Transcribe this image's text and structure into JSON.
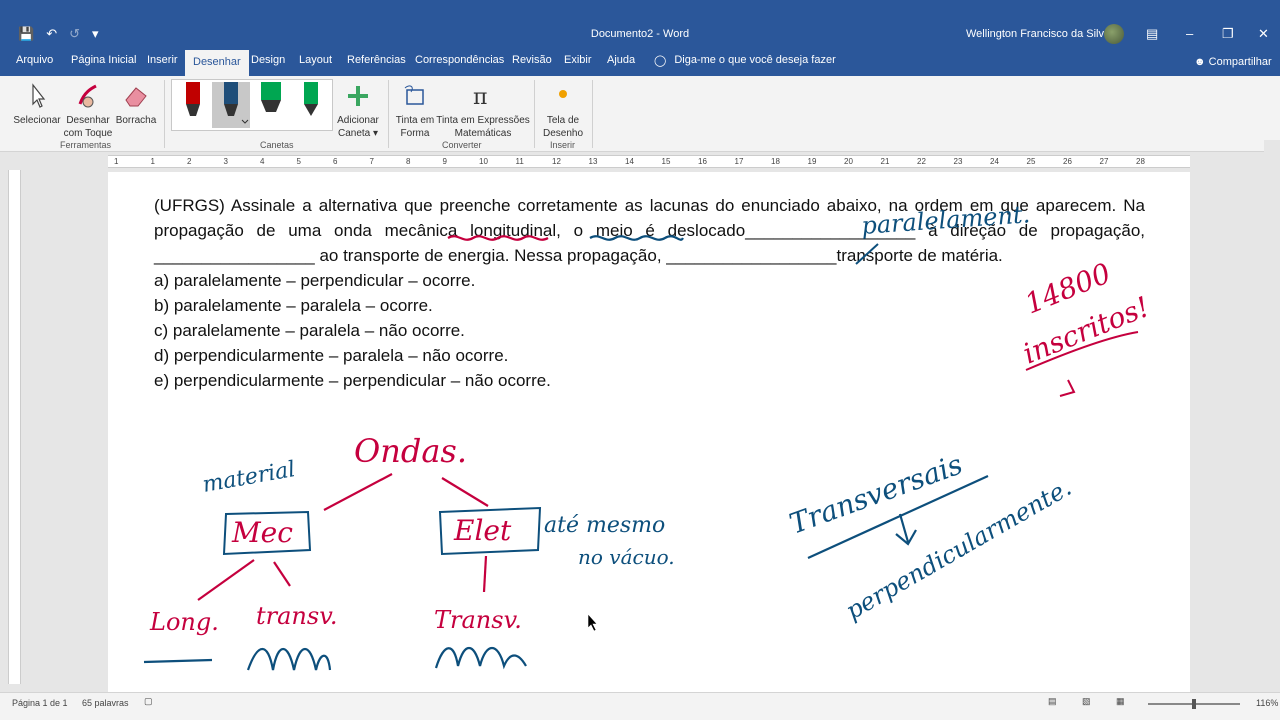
{
  "window": {
    "title": "Documento2  -  Word",
    "user": "Wellington Francisco da Silva"
  },
  "tabs": [
    "Arquivo",
    "Página Inicial",
    "Inserir",
    "Desenhar",
    "Design",
    "Layout",
    "Referências",
    "Correspondências",
    "Revisão",
    "Exibir",
    "Ajuda"
  ],
  "active_tab": "Desenhar",
  "tell_me": "Diga-me o que você deseja fazer",
  "share": "Compartilhar",
  "ribbon": {
    "select": "Selecionar",
    "draw_touch_1": "Desenhar",
    "draw_touch_2": "com Toque",
    "eraser": "Borracha",
    "group_tools": "Ferramentas",
    "group_pens": "Canetas",
    "add_pen_1": "Adicionar",
    "add_pen_2": "Caneta",
    "ink_shape_1": "Tinta em",
    "ink_shape_2": "Forma",
    "ink_math_1": "Tinta em Expressões",
    "ink_math_2": "Matemáticas",
    "group_convert": "Converter",
    "canvas_1": "Tela de",
    "canvas_2": "Desenho",
    "group_insert": "Inserir",
    "pen_colors": [
      "#c00000",
      "#1f4e79",
      "#00a651",
      "#00a651"
    ]
  },
  "ruler_numbers": [
    "1",
    "1",
    "2",
    "3",
    "4",
    "5",
    "6",
    "7",
    "8",
    "9",
    "10",
    "11",
    "12",
    "13",
    "14",
    "15",
    "16",
    "17",
    "18",
    "19",
    "20",
    "21",
    "22",
    "23",
    "24",
    "25",
    "26",
    "27",
    "28"
  ],
  "document": {
    "paragraph": "(UFRGS) Assinale a alternativa que preenche corretamente as lacunas do enunciado abaixo, na ordem em que aparecem. Na propagação de uma onda mecânica longitudinal, o meio é deslocado__________________ à direção de propagação, _________________ ao transporte de energia.  Nessa propagação, __________________transporte de matéria.",
    "options": [
      "a) paralelamente – perpendicular – ocorre.",
      "b) paralelamente – paralela – ocorre.",
      "c) paralelamente – paralela – não ocorre.",
      "d) perpendicularmente – paralela – não ocorre.",
      "e) perpendicularmente – perpendicular – não ocorre."
    ],
    "handwriting": {
      "answer_blank": "paralelament.",
      "count_1": "14800",
      "count_2": "inscritos!",
      "ondas": "Ondas.",
      "material": "material",
      "mec": "Mec",
      "elet": "Elet",
      "ate_mesmo": "até mesmo",
      "no_vacuo": "no vácuo.",
      "long": "Long.",
      "transv_1": "transv.",
      "transv_2": "Transv.",
      "transversais": "Transversais",
      "perpendicularmente": "perpendicularmente."
    },
    "ink_colors": {
      "red": "#c5003e",
      "blue": "#0d4f7c"
    }
  },
  "status": {
    "page": "Página 1 de 1",
    "words": "65 palavras",
    "zoom": "116%"
  }
}
